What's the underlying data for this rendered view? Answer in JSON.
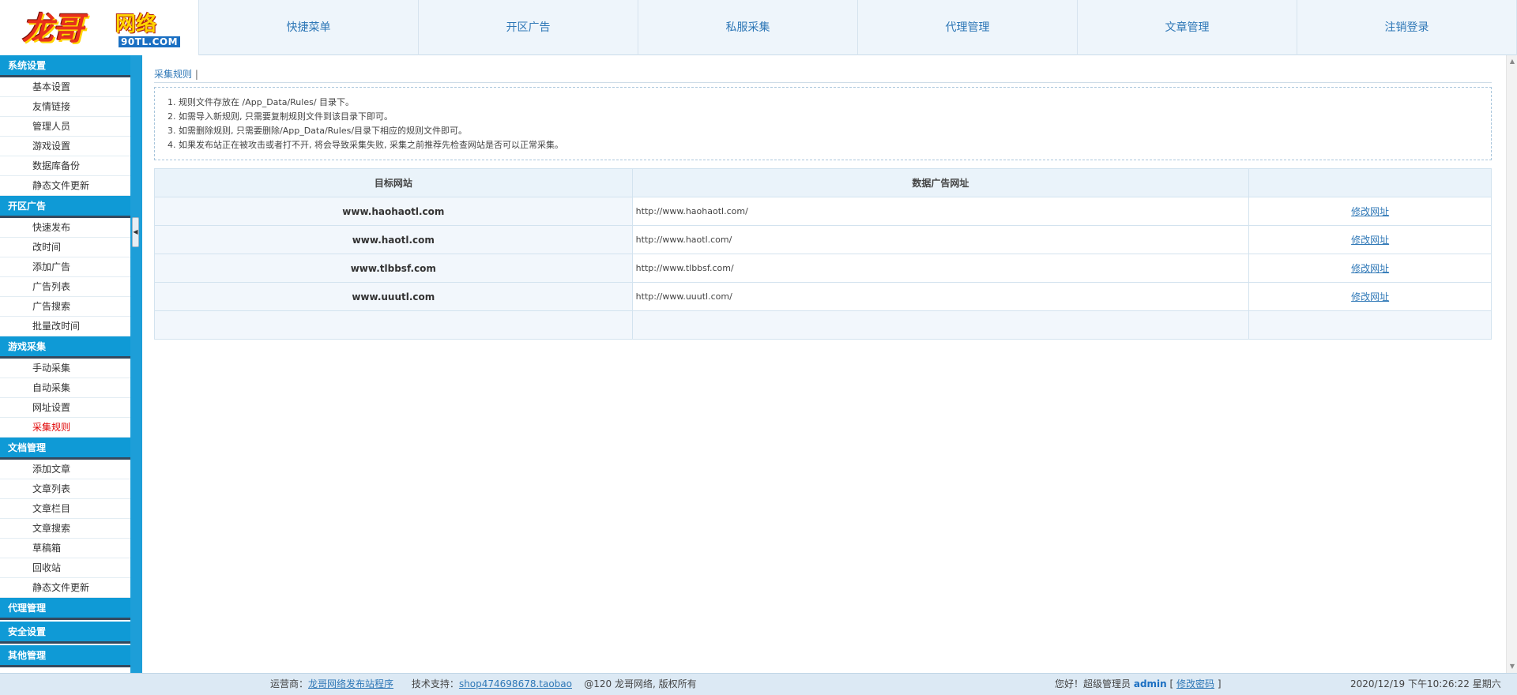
{
  "logo": {
    "main": "龙哥",
    "side": "网络",
    "sub": "90TL.COM"
  },
  "topnav": [
    "快捷菜单",
    "开区广告",
    "私服采集",
    "代理管理",
    "文章管理",
    "注销登录"
  ],
  "sidebar": {
    "groups": [
      {
        "title": "系统设置",
        "items": [
          "基本设置",
          "友情链接",
          "管理人员",
          "游戏设置",
          "数据库备份",
          "静态文件更新"
        ]
      },
      {
        "title": "开区广告",
        "items": [
          "快速发布",
          "改时间",
          "添加广告",
          "广告列表",
          "广告搜索",
          "批量改时间"
        ]
      },
      {
        "title": "游戏采集",
        "items": [
          "手动采集",
          "自动采集",
          "网址设置",
          "采集规则"
        ]
      },
      {
        "title": "文档管理",
        "items": [
          "添加文章",
          "文章列表",
          "文章栏目",
          "文章搜索",
          "草稿箱",
          "回收站",
          "静态文件更新"
        ]
      },
      {
        "title": "代理管理",
        "items": []
      },
      {
        "title": "安全设置",
        "items": []
      },
      {
        "title": "其他管理",
        "items": []
      }
    ],
    "active_item": "采集规则"
  },
  "breadcrumb": {
    "label": "采集规则",
    "sep": "|"
  },
  "notes": [
    "规则文件存放在 /App_Data/Rules/ 目录下。",
    "如需导入新规则, 只需要复制规则文件到该目录下即可。",
    "如需删除规则, 只需要删除/App_Data/Rules/目录下相应的规则文件即可。",
    "如果发布站正在被攻击或者打不开, 将会导致采集失败, 采集之前推荐先检查网站是否可以正常采集。"
  ],
  "table": {
    "headers": [
      "目标网站",
      "数据广告网址",
      ""
    ],
    "rows": [
      {
        "site": "www.haohaotl.com",
        "url": "http://www.haohaotl.com/",
        "action": "修改网址"
      },
      {
        "site": "www.haotl.com",
        "url": "http://www.haotl.com/",
        "action": "修改网址"
      },
      {
        "site": "www.tlbbsf.com",
        "url": "http://www.tlbbsf.com/",
        "action": "修改网址"
      },
      {
        "site": "www.uuutl.com",
        "url": "http://www.uuutl.com/",
        "action": "修改网址"
      }
    ]
  },
  "footer": {
    "operator_label": "运营商：",
    "operator_link": "龙哥网络发布站程序",
    "support_label": "技术支持：",
    "support_link": "shop474698678.taobao",
    "copyright": "@120 龙哥网络, 版权所有",
    "greeting": "您好！超级管理员",
    "user": "admin",
    "bracket_open": "[",
    "change_pwd": "修改密码",
    "bracket_close": "]",
    "datetime": "2020/12/19 下午10:26:22 星期六"
  },
  "colors": {
    "accent": "#0f9ad6",
    "link": "#2f78b7",
    "active": "#e00000"
  },
  "icons": {
    "collapse": "chevron-left-icon",
    "scroll_up": "arrow-up-icon",
    "scroll_down": "arrow-down-icon"
  }
}
